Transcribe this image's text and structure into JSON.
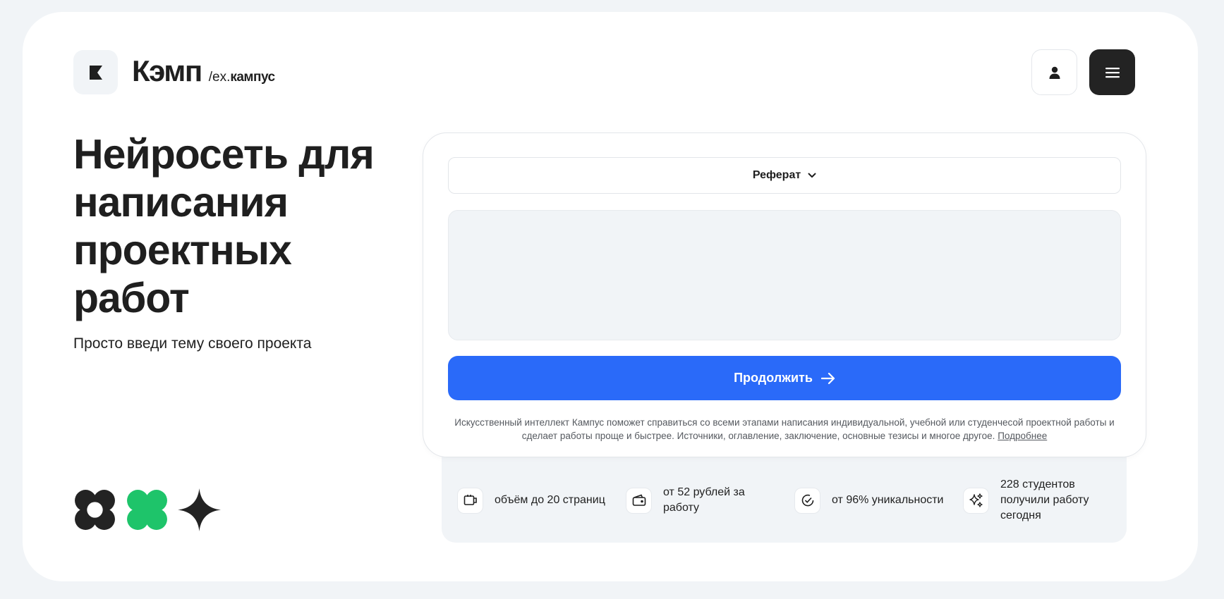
{
  "header": {
    "brand_name": "Кэмп",
    "brand_ex_prefix": "/ex.",
    "brand_ex_name": "кампус"
  },
  "hero": {
    "title": "Нейросеть для написания проектных работ",
    "subtitle": "Просто введи тему своего проекта"
  },
  "form": {
    "work_type_selected": "Реферат",
    "topic_value": "",
    "continue_label": "Продолжить",
    "disclaimer_text": "Искусственный интеллект Кампус поможет справиться со всеми этапами написания индивидуальной, учебной или студенчесой проектной работы и сделает работы проще и быстрее. Источники, оглавление, заключение, основные тезисы и многое другое.",
    "more_link": "Подробнее"
  },
  "features": [
    {
      "icon": "book-icon",
      "text": "объём до 20 страниц"
    },
    {
      "icon": "wallet-icon",
      "text": "от 52 рублей за работу"
    },
    {
      "icon": "check-circle-icon",
      "text": "от 96% уникальности"
    },
    {
      "icon": "sparkles-icon",
      "text": "228 студентов получили работу сегодня"
    }
  ],
  "colors": {
    "accent": "#2a6af9",
    "green": "#1ec46a",
    "dark": "#232323",
    "background": "#f1f4f7"
  }
}
